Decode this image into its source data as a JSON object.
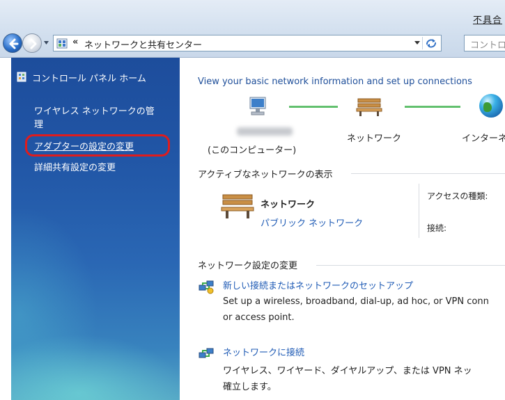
{
  "top_link": "不具合",
  "address_bar": {
    "chevron": "«",
    "path": "ネットワークと共有センター",
    "search_placeholder": "コントロ"
  },
  "sidebar": {
    "home": "コントロール パネル ホーム",
    "wireless_manage_line1": "ワイヤレス ネットワークの管",
    "wireless_manage_line2": "理",
    "adapter_settings": "アダプターの設定の変更",
    "advanced_sharing": "詳細共有設定の変更"
  },
  "main": {
    "heading": "View your basic network information and set up connections",
    "map": {
      "computer_label": "(このコンピューター)",
      "network_label": "ネットワーク",
      "internet_label": "インターネ"
    },
    "active_networks_title": "アクティブなネットワークの表示",
    "network": {
      "name": "ネットワーク",
      "type": "パブリック ネットワーク",
      "access_type_label": "アクセスの種類:",
      "connection_label": "接続:"
    },
    "change_settings_title": "ネットワーク設定の変更",
    "tasks": [
      {
        "link": "新しい接続またはネットワークのセットアップ",
        "desc_line1": "Set up a wireless, broadband, dial-up, ad hoc, or VPN conn",
        "desc_line2": "or access point."
      },
      {
        "link": "ネットワークに接続",
        "desc_line1": "ワイヤレス、ワイヤード、ダイヤルアップ、または VPN ネッ",
        "desc_line2": "確立します。"
      }
    ]
  },
  "colors": {
    "link_blue": "#1f5bb5",
    "sidebar_blue": "#2156a6",
    "highlight_red": "#e01c1c",
    "map_line_green": "#62c06e"
  }
}
